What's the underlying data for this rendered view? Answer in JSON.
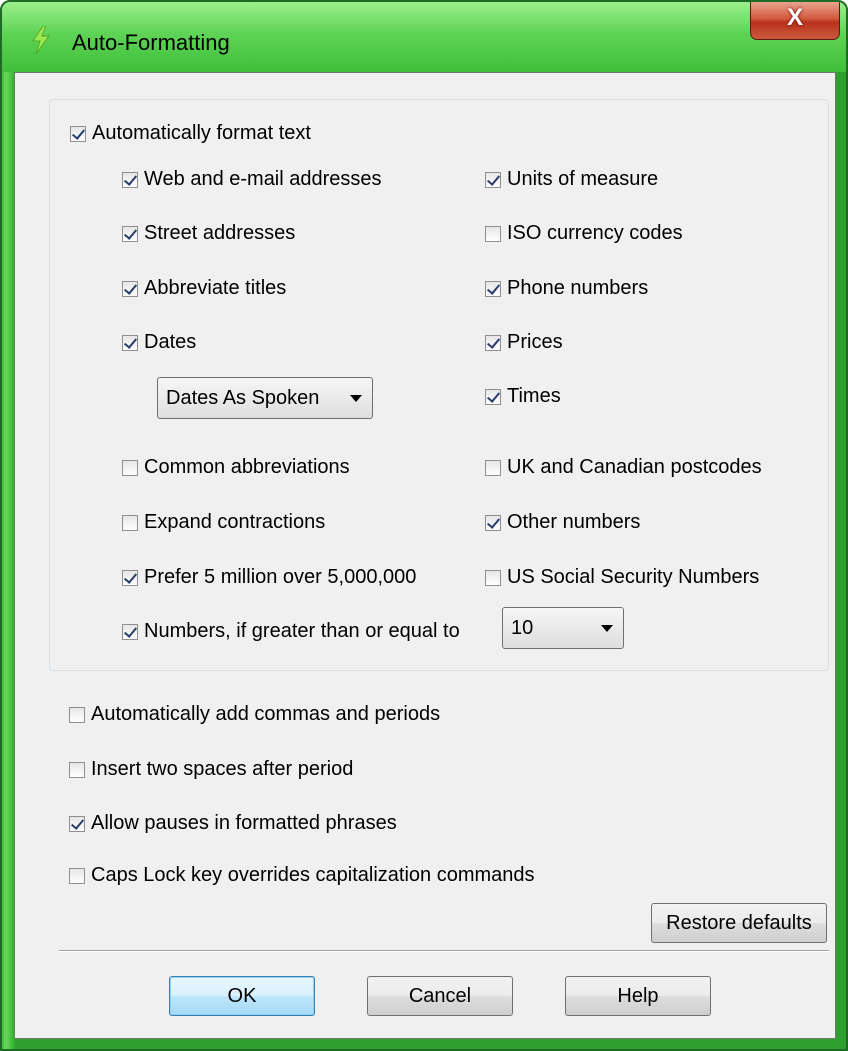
{
  "window": {
    "title": "Auto-Formatting",
    "close_label": "X"
  },
  "group": {
    "auto_format": {
      "label": "Automatically format text",
      "checked": true
    },
    "left": [
      {
        "label": "Web and e-mail addresses",
        "checked": true
      },
      {
        "label": "Street addresses",
        "checked": true
      },
      {
        "label": "Abbreviate titles",
        "checked": true
      },
      {
        "label": "Dates",
        "checked": true
      },
      {
        "label": "Common abbreviations",
        "checked": false
      },
      {
        "label": "Expand contractions",
        "checked": false
      },
      {
        "label": "Prefer 5 million over 5,000,000",
        "checked": true
      },
      {
        "label": "Numbers, if greater than or equal to",
        "checked": true
      }
    ],
    "right": [
      {
        "label": "Units of measure",
        "checked": true
      },
      {
        "label": "ISO currency codes",
        "checked": false
      },
      {
        "label": "Phone numbers",
        "checked": true
      },
      {
        "label": "Prices",
        "checked": true
      },
      {
        "label": "Times",
        "checked": true
      },
      {
        "label": "UK and Canadian postcodes",
        "checked": false
      },
      {
        "label": "Other numbers",
        "checked": true
      },
      {
        "label": "US Social Security Numbers",
        "checked": false
      }
    ],
    "dates_dropdown": "Dates As Spoken",
    "numbers_dropdown": "10"
  },
  "options": [
    {
      "label": "Automatically add commas and periods",
      "checked": false
    },
    {
      "label": "Insert two spaces after period",
      "checked": false
    },
    {
      "label": "Allow pauses in formatted phrases",
      "checked": true
    },
    {
      "label": "Caps Lock key overrides capitalization commands",
      "checked": false
    }
  ],
  "buttons": {
    "restore": "Restore defaults",
    "ok": "OK",
    "cancel": "Cancel",
    "help": "Help"
  },
  "colors": {
    "title_green": "#5fd356",
    "close_red": "#c8452a",
    "check_mark": "#2a3c6e"
  }
}
